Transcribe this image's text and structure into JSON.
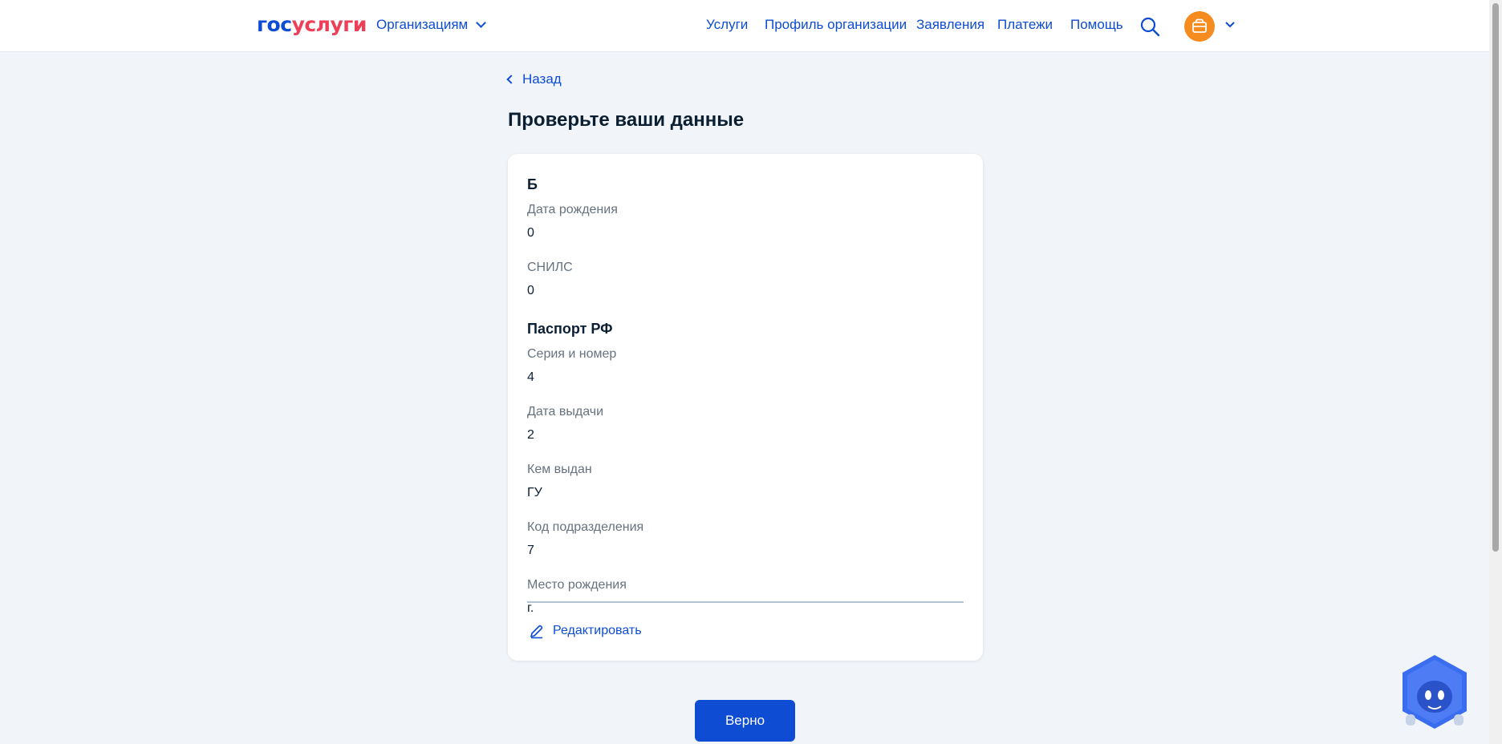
{
  "header": {
    "logo_part1": "гос",
    "logo_part2": "услуги",
    "org_menu_label": "Организациям",
    "nav": [
      {
        "label": "Услуги"
      },
      {
        "label": "Профиль организации"
      },
      {
        "label": "Заявления"
      },
      {
        "label": "Платежи"
      },
      {
        "label": "Помощь"
      }
    ],
    "icons": {
      "search": "search-icon",
      "avatar": "briefcase-icon",
      "menu": "chevron-down-icon"
    },
    "colors": {
      "brand_blue": "#0d4cd3",
      "brand_red": "#ee3f58",
      "avatar_orange": "#f68c1f"
    }
  },
  "page": {
    "back_label": "Назад",
    "title": "Проверьте ваши данные"
  },
  "card": {
    "name": "Б",
    "personal": [
      {
        "label": "Дата рождения",
        "value": "0"
      },
      {
        "label": "СНИЛС",
        "value": "0"
      }
    ],
    "passport_title": "Паспорт РФ",
    "passport": [
      {
        "label": "Серия и номер",
        "value": "4"
      },
      {
        "label": "Дата выдачи",
        "value": "2"
      },
      {
        "label": "Кем выдан",
        "value": "ГУ"
      },
      {
        "label": "Код подразделения",
        "value": "7"
      },
      {
        "label": "Место рождения",
        "value": "г."
      }
    ],
    "edit_label": "Редактировать"
  },
  "actions": {
    "confirm_label": "Верно"
  }
}
